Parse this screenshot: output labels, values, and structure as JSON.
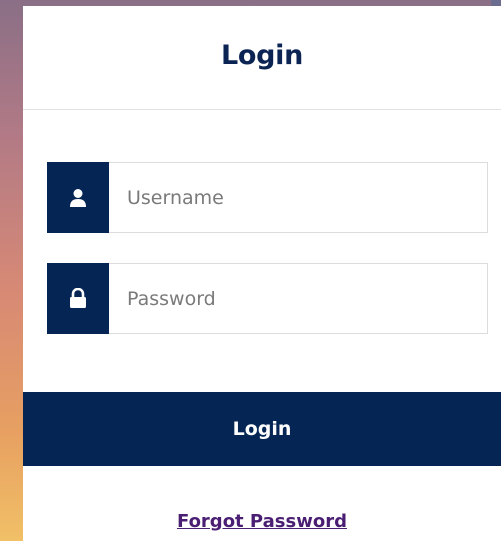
{
  "login_form": {
    "title": "Login",
    "username": {
      "placeholder": "Username",
      "value": "",
      "icon": "user-icon"
    },
    "password": {
      "placeholder": "Password",
      "value": "",
      "icon": "lock-icon"
    },
    "submit_label": "Login",
    "forgot_password_label": "Forgot Password"
  },
  "colors": {
    "primary": "#052555",
    "title": "#0b2454",
    "link": "#4a1f73",
    "card_background": "#ffffff"
  }
}
